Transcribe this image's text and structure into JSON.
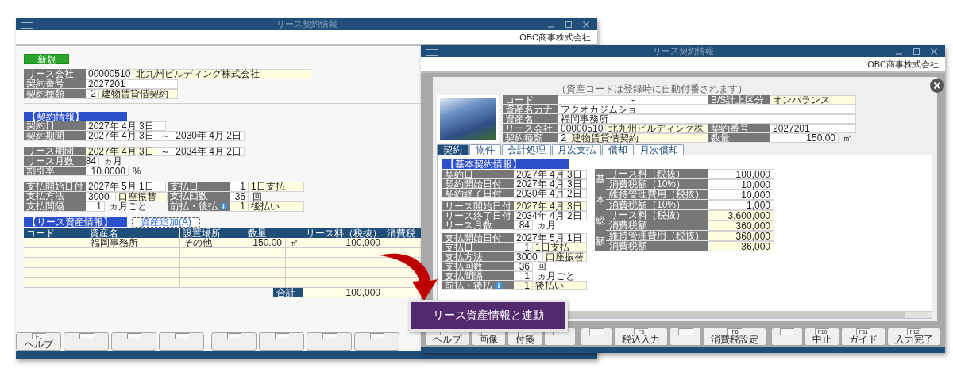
{
  "left_window": {
    "title": "リース契約情報",
    "company": "OBC商事株式会社",
    "mode": "新規",
    "header_rows": [
      {
        "label": "リース会社",
        "info": false,
        "cells": [
          {
            "kind": "code",
            "text": "00000510",
            "highlight": false
          },
          {
            "kind": "wide",
            "text": "北九州ビルディング株式会社",
            "highlight": true
          }
        ]
      },
      {
        "label": "契約番号",
        "info": false,
        "cells": [
          {
            "kind": "text",
            "text": "2027201",
            "highlight": false
          }
        ]
      },
      {
        "label": "契約種類",
        "info": false,
        "cells": [
          {
            "kind": "short",
            "text": "2",
            "highlight": false
          },
          {
            "kind": "name",
            "text": "建物賃貸借契約",
            "highlight": true
          }
        ]
      }
    ],
    "contract_section": {
      "title": "【契約情報】",
      "groups": [
        [
          {
            "label": "契約日",
            "info": false,
            "cells": [
              {
                "kind": "date",
                "text": "2027年 4月 3日",
                "highlight": false
              }
            ]
          },
          {
            "label": "契約期間",
            "info": false,
            "cells": [
              {
                "kind": "range",
                "from": "2027年 4月 3日",
                "sep": "～",
                "to": "2030年 4月 2日",
                "highlight": false
              }
            ]
          }
        ],
        [
          {
            "label": "リース期間",
            "info": false,
            "cells": [
              {
                "kind": "range",
                "from": "2027年 4月 3日",
                "sep": "～",
                "to": "2034年 4月 2日",
                "highlight": true
              }
            ]
          },
          {
            "label": "リース月数",
            "info": false,
            "cells": [
              {
                "kind": "short",
                "text": "84",
                "highlight": false
              },
              {
                "kind": "unit",
                "text": "ヵ月"
              }
            ]
          },
          {
            "label": "割引率",
            "info": false,
            "cells": [
              {
                "kind": "rate",
                "text": "10.0000",
                "highlight": false
              },
              {
                "kind": "unit",
                "text": "%"
              }
            ]
          }
        ],
        [
          {
            "label": "支払開始日付",
            "info": false,
            "cells": [
              {
                "kind": "date",
                "text": "2027年 5月 1日",
                "highlight": false
              }
            ],
            "pair": {
              "label": "支払日",
              "info": false,
              "cells": [
                {
                  "kind": "short",
                  "text": "1",
                  "highlight": false
                },
                {
                  "kind": "name",
                  "text": "1日支払",
                  "highlight": true
                }
              ]
            }
          },
          {
            "label": "支払方法",
            "info": false,
            "cells": [
              {
                "kind": "code",
                "text": "3000",
                "highlight": false
              },
              {
                "kind": "name",
                "text": "口座振替",
                "highlight": true
              }
            ],
            "pair": {
              "label": "支払回数",
              "info": false,
              "cells": [
                {
                  "kind": "short",
                  "text": "36",
                  "highlight": false
                },
                {
                  "kind": "unit",
                  "text": "回"
                }
              ]
            }
          },
          {
            "label": "支払間隔",
            "info": false,
            "cells": [
              {
                "kind": "short",
                "text": "1",
                "highlight": false
              },
              {
                "kind": "unit",
                "text": "ヵ月ごと"
              }
            ],
            "pair": {
              "label": "前払・後払",
              "info": true,
              "cells": [
                {
                  "kind": "short",
                  "text": "1",
                  "highlight": true
                },
                {
                  "kind": "name",
                  "text": "後払い",
                  "highlight": true
                }
              ]
            }
          }
        ]
      ]
    },
    "asset_section": {
      "title": "【リース資産情報】",
      "add_button": "資産追加(A)",
      "columns": [
        {
          "kind": "text",
          "title": "コード"
        },
        {
          "kind": "text",
          "title": "資産名"
        },
        {
          "kind": "text",
          "title": "設置場所"
        },
        {
          "kind": "measure",
          "title": "数量"
        },
        {
          "kind": "number",
          "title": "リース料（税抜）"
        },
        {
          "kind": "number",
          "title": "消費税"
        }
      ],
      "rows": [
        {
          "asset_name": "福岡事務所",
          "location": "その他",
          "quantity": "150.00",
          "unit": "㎡",
          "lease_fee": "100,000"
        }
      ],
      "total_label": "合計",
      "total_value": "100,000"
    },
    "function_keys": [
      {
        "kind": "labeled",
        "key": "F1",
        "label": "ヘルプ"
      },
      {
        "kind": "blank"
      },
      {
        "kind": "blank"
      },
      {
        "kind": "blank"
      },
      {
        "kind": "blank"
      },
      {
        "kind": "blank"
      },
      {
        "kind": "blank"
      },
      {
        "kind": "blank"
      }
    ]
  },
  "right_window": {
    "title": "リース契約情報",
    "company": "OBC商事株式会社",
    "dialog": {
      "note": "（資産コードは登録時に自動付番されます）",
      "info_rows": [
        {
          "label": "コード",
          "info": false,
          "cells": [
            {
              "kind": "dash",
              "text": "-",
              "highlight": false
            }
          ],
          "pair": {
            "label": "B/S計上区分",
            "info": false,
            "cells": [
              {
                "kind": "name",
                "text": "オンバランス",
                "highlight": true
              }
            ]
          }
        },
        {
          "label": "資産名カナ",
          "info": false,
          "cells": [
            {
              "kind": "wide",
              "text": "フクオカジムショ",
              "highlight": false
            }
          ]
        },
        {
          "label": "資産名",
          "info": false,
          "cells": [
            {
              "kind": "wide",
              "text": "福岡事務所",
              "highlight": false
            }
          ]
        },
        {
          "label": "リース会社",
          "info": false,
          "cells": [
            {
              "kind": "code",
              "text": "00000510",
              "highlight": false
            },
            {
              "kind": "name",
              "text": "北九州ビルディング株",
              "highlight": true
            }
          ],
          "pair": {
            "label": "契約番号",
            "info": false,
            "cells": [
              {
                "kind": "text",
                "text": "2027201",
                "highlight": false
              }
            ]
          }
        },
        {
          "label": "契約種類",
          "info": false,
          "cells": [
            {
              "kind": "short",
              "text": "2",
              "highlight": false
            },
            {
              "kind": "name",
              "text": "建物賃貸借契約",
              "highlight": true
            }
          ],
          "pair": {
            "label": "数量",
            "info": false,
            "cells": [
              {
                "kind": "amount",
                "text": "150.00",
                "highlight": false
              },
              {
                "kind": "unit",
                "text": "㎡"
              }
            ]
          }
        }
      ],
      "tabs": [
        {
          "label": "契約",
          "selected": true
        },
        {
          "label": "物件",
          "selected": false
        },
        {
          "label": "会計処理",
          "selected": false
        },
        {
          "label": "月次支払",
          "selected": false
        },
        {
          "label": "償却",
          "selected": false
        },
        {
          "label": "月次償却",
          "selected": false
        }
      ],
      "basic_section": {
        "title": "【基本契約情報】",
        "groups": [
          [
            {
              "label": "契約日",
              "info": false,
              "cells": [
                {
                  "kind": "date",
                  "text": "2027年 4月 3日",
                  "highlight": false
                }
              ]
            },
            {
              "label": "契約開始日付",
              "info": false,
              "cells": [
                {
                  "kind": "date",
                  "text": "2027年 4月 3日",
                  "highlight": false
                }
              ]
            },
            {
              "label": "契約終了日付",
              "info": false,
              "cells": [
                {
                  "kind": "date",
                  "text": "2030年 4月 2日",
                  "highlight": false
                }
              ]
            }
          ],
          [
            {
              "label": "リース開始日付",
              "info": false,
              "cells": [
                {
                  "kind": "date",
                  "text": "2027年 4月 3日",
                  "highlight": true
                }
              ]
            },
            {
              "label": "リース終了日付",
              "info": false,
              "cells": [
                {
                  "kind": "date",
                  "text": "2034年 4月 2日",
                  "highlight": false
                }
              ]
            },
            {
              "label": "リース月数",
              "info": false,
              "cells": [
                {
                  "kind": "short",
                  "text": "84",
                  "highlight": false
                },
                {
                  "kind": "unit",
                  "text": "ヵ月"
                }
              ]
            }
          ],
          [
            {
              "label": "支払開始日付",
              "info": false,
              "cells": [
                {
                  "kind": "date",
                  "text": "2027年 5月 1日",
                  "highlight": false
                }
              ]
            },
            {
              "label": "支払日",
              "info": false,
              "cells": [
                {
                  "kind": "short",
                  "text": "1",
                  "highlight": false
                },
                {
                  "kind": "name",
                  "text": "1日支払",
                  "highlight": true
                }
              ]
            },
            {
              "label": "支払方法",
              "info": false,
              "cells": [
                {
                  "kind": "code",
                  "text": "3000",
                  "highlight": false
                },
                {
                  "kind": "name",
                  "text": "口座振替",
                  "highlight": true
                }
              ]
            },
            {
              "label": "支払回数",
              "info": false,
              "cells": [
                {
                  "kind": "short",
                  "text": "36",
                  "highlight": false
                },
                {
                  "kind": "unit",
                  "text": "回"
                }
              ]
            },
            {
              "label": "支払間隔",
              "info": false,
              "cells": [
                {
                  "kind": "short",
                  "text": "1",
                  "highlight": false
                },
                {
                  "kind": "unit",
                  "text": "ヵ月ごと"
                }
              ]
            },
            {
              "label": "前払・後払",
              "info": true,
              "cells": [
                {
                  "kind": "short",
                  "text": "1",
                  "highlight": true
                },
                {
                  "kind": "name",
                  "text": "後払い",
                  "highlight": true
                }
              ]
            }
          ]
        ]
      },
      "totals": {
        "heading": "基本総額",
        "rows": [
          {
            "label": "リース料（税抜）",
            "value": "100,000",
            "highlight": false
          },
          {
            "label": "消費税額（10%）",
            "value": "10,000",
            "highlight": false
          },
          {
            "label": "維持管理費用（税抜）",
            "value": "10,000",
            "highlight": false
          },
          {
            "label": "消費税額（10%）",
            "value": "1,000",
            "highlight": false
          },
          {
            "label": "リース料（税抜）",
            "value": "3,600,000",
            "highlight": true
          },
          {
            "label": "消費税額",
            "value": "360,000",
            "highlight": true
          },
          {
            "label": "維持管理費用（税抜）",
            "value": "360,000",
            "highlight": true
          },
          {
            "label": "消費税額",
            "value": "36,000",
            "highlight": true
          }
        ]
      }
    },
    "function_keys": [
      {
        "kind": "labeled",
        "label": "ヘルプ"
      },
      {
        "kind": "labeled",
        "label": "画像"
      },
      {
        "kind": "labeled",
        "label": "付箋"
      },
      {
        "kind": "blank"
      },
      {
        "kind": "blank"
      },
      {
        "kind": "labeled",
        "key": "F6",
        "label": "税込入力"
      },
      {
        "kind": "blank"
      },
      {
        "kind": "labeled",
        "key": "F8",
        "label": "消費税設定"
      },
      {
        "kind": "blank"
      },
      {
        "kind": "labeled",
        "key": "F10",
        "label": "中止"
      },
      {
        "kind": "labeled",
        "key": "F11",
        "label": "ガイド"
      },
      {
        "kind": "labeled",
        "key": "F12",
        "label": "入力完了"
      }
    ]
  },
  "callout": {
    "text": "リース資産情報と連動"
  }
}
